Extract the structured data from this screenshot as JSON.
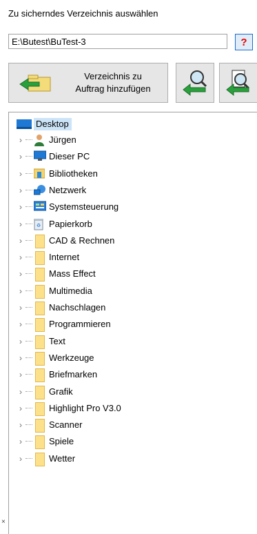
{
  "header": {
    "title": "Zu sicherndes Verzeichnis auswählen",
    "path_value": "E:\\Butest\\BuTest-3",
    "help_label": "?"
  },
  "toolbar": {
    "add_line1": "Verzeichnis zu",
    "add_line2": "Auftrag hinzufügen"
  },
  "tree": {
    "root": "Desktop",
    "items": [
      {
        "label": "Jürgen",
        "icon": "user-icon"
      },
      {
        "label": "Dieser PC",
        "icon": "computer-icon"
      },
      {
        "label": "Bibliotheken",
        "icon": "library-icon"
      },
      {
        "label": "Netzwerk",
        "icon": "network-icon"
      },
      {
        "label": "Systemsteuerung",
        "icon": "control-panel-icon"
      },
      {
        "label": "Papierkorb",
        "icon": "recycle-bin-icon"
      },
      {
        "label": "CAD & Rechnen",
        "icon": "folder-icon"
      },
      {
        "label": "Internet",
        "icon": "folder-icon"
      },
      {
        "label": "Mass Effect",
        "icon": "folder-icon"
      },
      {
        "label": "Multimedia",
        "icon": "folder-icon"
      },
      {
        "label": "Nachschlagen",
        "icon": "folder-icon"
      },
      {
        "label": "Programmieren",
        "icon": "folder-icon"
      },
      {
        "label": "Text",
        "icon": "folder-icon"
      },
      {
        "label": "Werkzeuge",
        "icon": "folder-icon"
      },
      {
        "label": "Briefmarken",
        "icon": "folder-icon"
      },
      {
        "label": "Grafik",
        "icon": "folder-icon"
      },
      {
        "label": "Highlight Pro V3.0",
        "icon": "folder-icon"
      },
      {
        "label": "Scanner",
        "icon": "folder-icon"
      },
      {
        "label": "Spiele",
        "icon": "folder-icon"
      },
      {
        "label": "Wetter",
        "icon": "folder-icon"
      }
    ]
  }
}
